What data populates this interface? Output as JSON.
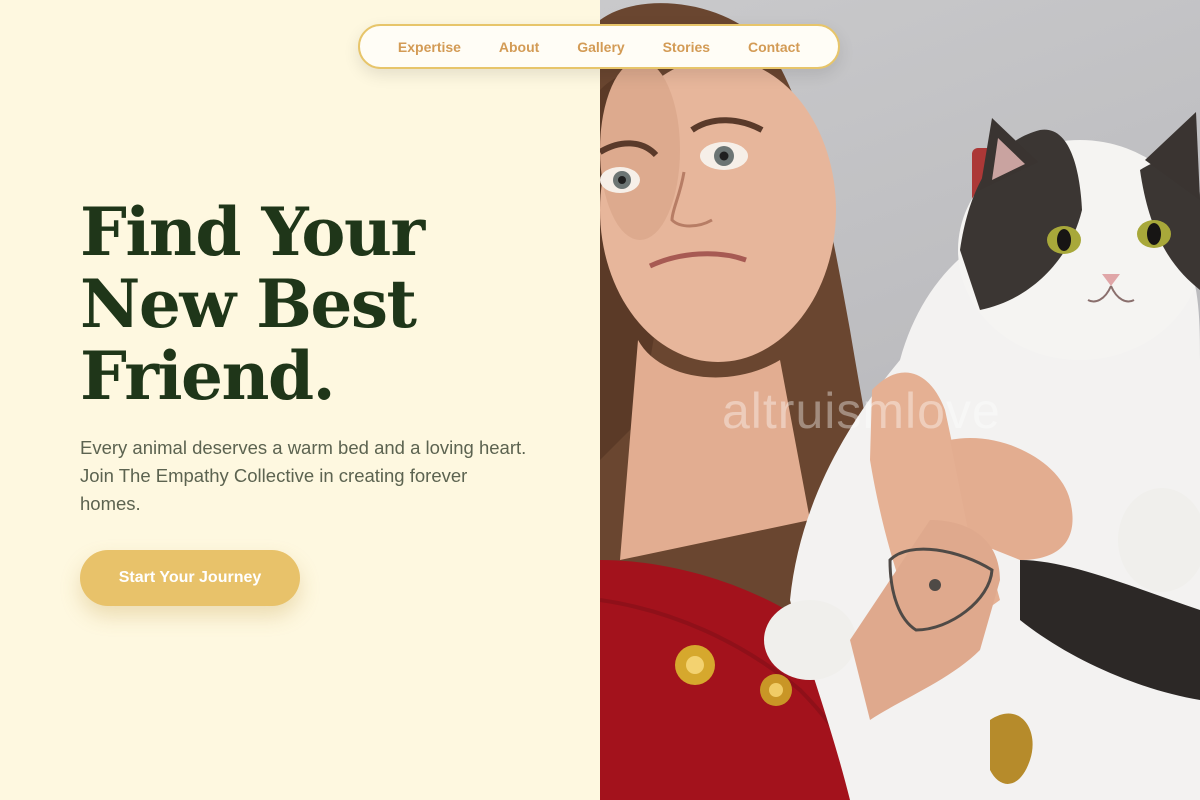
{
  "nav": {
    "items": [
      {
        "label": "Expertise"
      },
      {
        "label": "About"
      },
      {
        "label": "Gallery"
      },
      {
        "label": "Stories"
      },
      {
        "label": "Contact"
      }
    ]
  },
  "hero": {
    "title_lines": [
      "Find Your",
      "New Best",
      "Friend."
    ],
    "description": "Every animal deserves a warm bed and a loving heart. Join The Empathy Collective in creating forever homes.",
    "cta_label": "Start Your Journey"
  },
  "photo": {
    "subject": "woman holding a black and white cat",
    "watermark": "altruismlove"
  },
  "colors": {
    "background": "#fef8e0",
    "heading": "#1f3619",
    "body_text": "#5c6350",
    "nav_text": "#d39b55",
    "nav_border": "#e7c56a",
    "accent": "#e8c26a"
  }
}
